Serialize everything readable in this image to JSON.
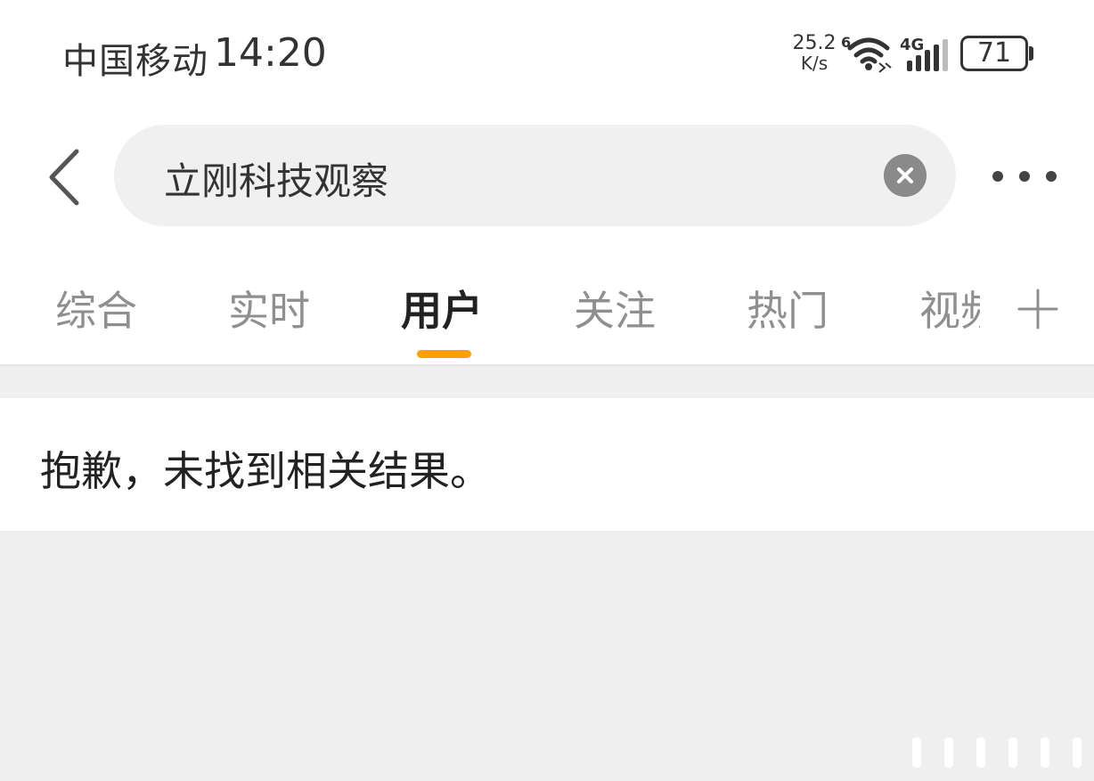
{
  "status_bar": {
    "carrier": "中国移动",
    "time": "14:20",
    "net_speed_value": "25.2",
    "net_speed_unit": "K/s",
    "wifi_label": "6",
    "signal_label": "4G",
    "battery": "71",
    "icons": [
      "wifi-icon",
      "signal-icon",
      "battery-icon"
    ]
  },
  "search": {
    "query": "立刚科技观察",
    "icons": [
      "back-arrow-icon",
      "clear-icon",
      "more-icon"
    ]
  },
  "tabs": [
    {
      "label": "综合",
      "active": false
    },
    {
      "label": "实时",
      "active": false
    },
    {
      "label": "用户",
      "active": true
    },
    {
      "label": "关注",
      "active": false
    },
    {
      "label": "热门",
      "active": false
    },
    {
      "label": "视频",
      "active": false
    }
  ],
  "add_tab_icon": "plus-icon",
  "result": {
    "empty_message": "抱歉，未找到相关结果。"
  },
  "colors": {
    "accent": "#ff9f00",
    "text_primary": "#222222",
    "text_secondary": "#8f8f8f",
    "background": "#efefef"
  }
}
